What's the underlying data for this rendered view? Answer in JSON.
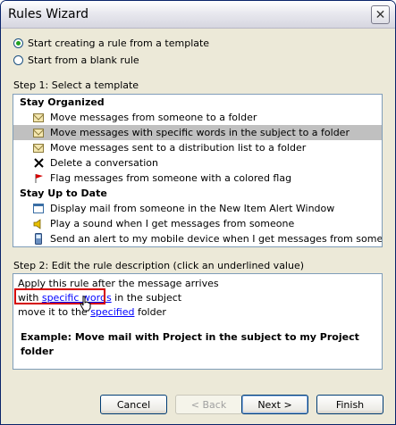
{
  "window": {
    "title": "Rules Wizard",
    "close_glyph": "✕"
  },
  "options": [
    {
      "label": "Start creating a rule from a template",
      "selected": true
    },
    {
      "label": "Start from a blank rule",
      "selected": false
    }
  ],
  "step1": {
    "label": "Step 1: Select a template",
    "groups": [
      {
        "header": "Stay Organized",
        "items": [
          {
            "label": "Move messages from someone to a folder",
            "icon": "envelope-folder-icon"
          },
          {
            "label": "Move messages with specific words in the subject to a folder",
            "icon": "envelope-folder-icon",
            "selected": true
          },
          {
            "label": "Move messages sent to a distribution list to a folder",
            "icon": "envelope-folder-icon"
          },
          {
            "label": "Delete a conversation",
            "icon": "delete-x-icon"
          },
          {
            "label": "Flag messages from someone with a colored flag",
            "icon": "red-flag-icon"
          }
        ]
      },
      {
        "header": "Stay Up to Date",
        "items": [
          {
            "label": "Display mail from someone in the New Item Alert Window",
            "icon": "alert-window-icon"
          },
          {
            "label": "Play a sound when I get messages from someone",
            "icon": "speaker-icon"
          },
          {
            "label": "Send an alert to my mobile device when I get messages from someone",
            "icon": "mobile-phone-icon"
          }
        ]
      }
    ]
  },
  "step2": {
    "label": "Step 2: Edit the rule description (click an underlined value)",
    "line1": "Apply this rule after the message arrives",
    "line2_prefix": "with ",
    "line2_link": "specific words",
    "line2_suffix": " in the subject",
    "line3_prefix": "move it to the ",
    "line3_link": "specified",
    "line3_suffix": " folder",
    "example": "Example: Move mail with Project in the subject to my Project folder"
  },
  "buttons": {
    "cancel": "Cancel",
    "back": "< Back",
    "next": "Next >",
    "finish": "Finish"
  },
  "colors": {
    "highlight": "#d40000",
    "selection": "#c0c0c0",
    "link": "#0000ff"
  }
}
